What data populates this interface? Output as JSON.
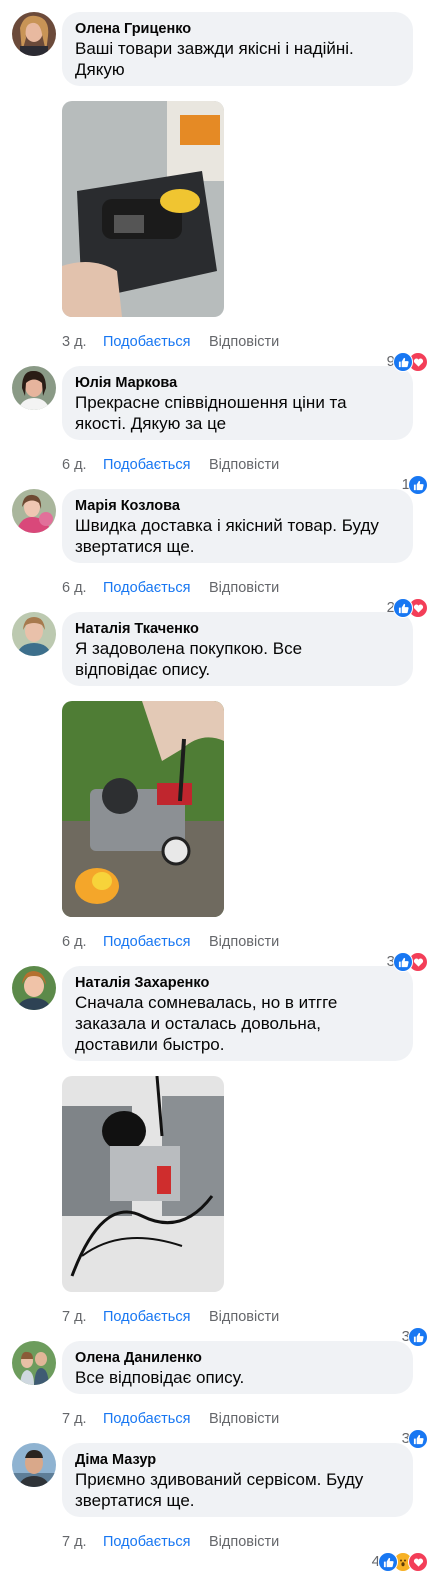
{
  "ui": {
    "like_label": "Подобається",
    "reply_label": "Відповісти"
  },
  "comments": [
    {
      "author": "Олена Гриценко",
      "text": "Ваші товари завжди якісні і надійні.\nДякую",
      "time": "3 д.",
      "reactions": "9",
      "reaction_types": [
        "like",
        "love"
      ],
      "has_photo": true,
      "photo_desc": "compressor-in-bag"
    },
    {
      "author": "Юлія Маркова",
      "text": "Прекрасне співвідношення ціни та\nякості. Дякую за це",
      "time": "6 д.",
      "reactions": "1",
      "reaction_types": [
        "like"
      ],
      "has_photo": false
    },
    {
      "author": "Марія Козлова",
      "text": "Швидка доставка і якісний товар. Буду\nзвертатися ще.",
      "time": "6 д.",
      "reactions": "2",
      "reaction_types": [
        "like",
        "love"
      ],
      "has_photo": false
    },
    {
      "author": "Наталія Ткаченко",
      "text": "Я задоволена покупкою. Все\nвідповідає опису.",
      "time": "6 д.",
      "reactions": "3",
      "reaction_types": [
        "like",
        "love"
      ],
      "has_photo": true,
      "photo_desc": "compressor-on-grass"
    },
    {
      "author": "Наталія Захаренко",
      "text": "Сначала сомневалась, но в итгге\nзаказала и осталась довольна,\nдоставили быстро.",
      "time": "7 д.",
      "reactions": "3",
      "reaction_types": [
        "like"
      ],
      "has_photo": true,
      "photo_desc": "compressor-closeup"
    },
    {
      "author": "Олена Даниленко",
      "text": "Все відповідає опису.",
      "time": "7 д.",
      "reactions": "3",
      "reaction_types": [
        "like"
      ],
      "has_photo": false
    },
    {
      "author": "Діма Мазур",
      "text": "Приємно здивований сервісом. Буду\nзвертатися ще.",
      "time": "7 д.",
      "reactions": "4",
      "reaction_types": [
        "like",
        "wow",
        "love"
      ],
      "has_photo": false
    }
  ],
  "colors": {
    "link": "#1877f2",
    "meta": "#65676b",
    "bubble": "#f0f2f5",
    "like": "#1877f2",
    "love": "#f33e58",
    "wow": "#f7b125"
  }
}
